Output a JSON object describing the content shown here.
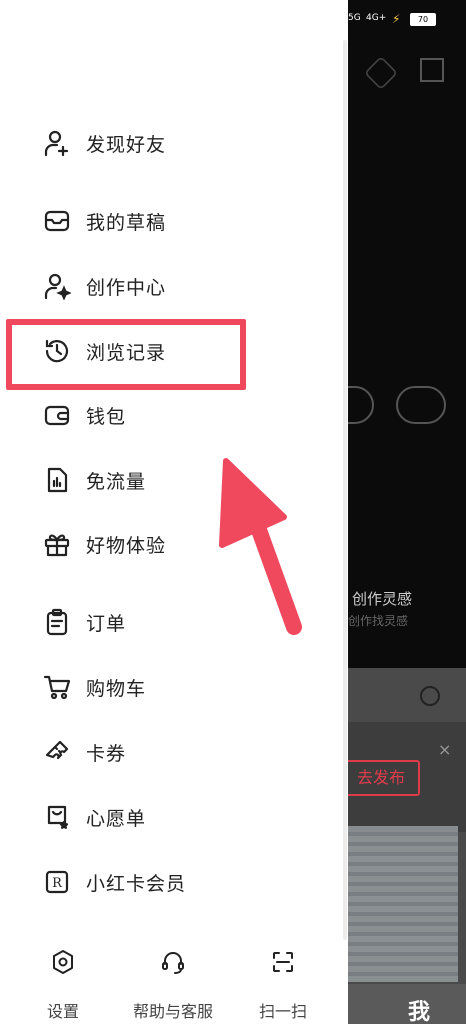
{
  "status_bar": {
    "net1": "5G",
    "net2": "4G+",
    "battery": "70"
  },
  "background": {
    "text_inspire": "创作灵感",
    "text_inspire_sub": "创作找灵感",
    "publish_label": "去发布",
    "close_glyph": "×",
    "tab_me": "我"
  },
  "drawer": {
    "items": [
      {
        "label": "发现好友",
        "icon": "add-friend-icon"
      },
      {
        "label": "我的草稿",
        "icon": "drafts-box-icon"
      },
      {
        "label": "创作中心",
        "icon": "creator-center-icon"
      },
      {
        "label": "浏览记录",
        "icon": "history-clock-icon"
      },
      {
        "label": "钱包",
        "icon": "wallet-icon"
      },
      {
        "label": "免流量",
        "icon": "free-data-icon"
      },
      {
        "label": "好物体验",
        "icon": "gift-icon"
      },
      {
        "label": "订单",
        "icon": "clipboard-icon"
      },
      {
        "label": "购物车",
        "icon": "cart-icon"
      },
      {
        "label": "卡券",
        "icon": "coupon-icon"
      },
      {
        "label": "心愿单",
        "icon": "wishlist-icon"
      },
      {
        "label": "小红卡会员",
        "icon": "red-card-icon"
      }
    ],
    "bottom": [
      {
        "label": "设置",
        "icon": "settings-icon"
      },
      {
        "label": "帮助与客服",
        "icon": "headset-icon"
      },
      {
        "label": "扫一扫",
        "icon": "scan-icon"
      }
    ],
    "red_card_letter": "R"
  },
  "annotation": {
    "highlight_color": "#f0485d"
  }
}
